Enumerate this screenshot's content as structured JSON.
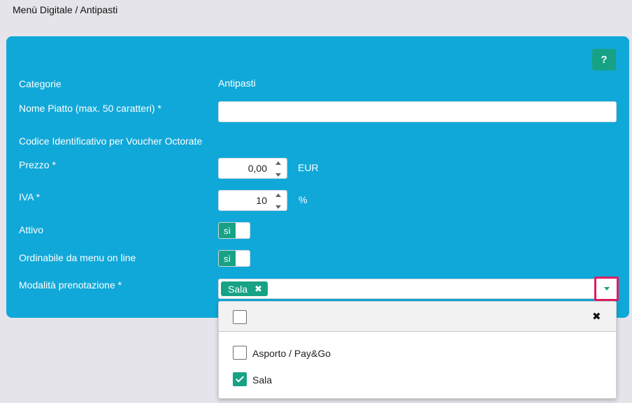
{
  "breadcrumb": "Menù Digitale / Antipasti",
  "help_label": "?",
  "form": {
    "category_label": "Categorie",
    "category_value": "Antipasti",
    "dish_name_label": "Nome Piatto (max. 50 caratteri)  *",
    "dish_name_value": "",
    "voucher_code_label": "Codice Identificativo per Voucher Octorate",
    "price_label": "Prezzo  *",
    "price_value": "0,00",
    "price_unit": "EUR",
    "vat_label": "IVA  *",
    "vat_value": "10",
    "vat_unit": "%",
    "active_label": "Attivo",
    "active_toggle": "sì",
    "orderable_label": "Ordinabile da menu on line",
    "orderable_toggle": "sì",
    "booking_mode_label": "Modalità prenotazione  *",
    "booking_mode_selected_tag": "Sala"
  },
  "dropdown": {
    "options": [
      {
        "label": "Asporto / Pay&Go",
        "checked": false
      },
      {
        "label": "Sala",
        "checked": true
      }
    ]
  },
  "colors": {
    "panel": "#10a8d8",
    "accent": "#17a285",
    "highlight": "#e01c62"
  }
}
